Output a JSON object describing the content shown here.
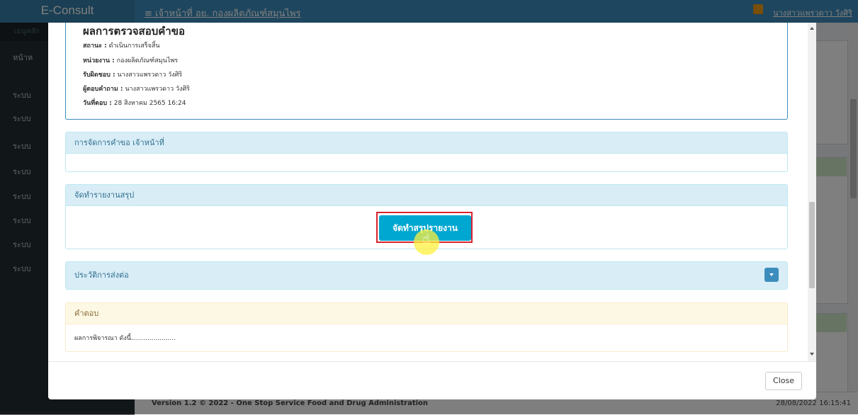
{
  "app": {
    "logo": "E-Consult",
    "header_title": "≡  เจ้าหน้าที่ อย. กองผลิตภัณฑ์สมุนไพร",
    "user_name": "นางสาวแพรวดาว วังศิริ",
    "sidebar_head": "เมนูหลัก",
    "sidebar_items": [
      "หน้าห",
      "ระบบ",
      "ระบบ",
      "ระบบ",
      "ระบบ",
      "ระบบ",
      "ระบบ",
      "ระบบ",
      "ระบบ"
    ],
    "footer_text": "Version 1.2 © 2022 - One Stop Service Food and Drug Administration",
    "footer_time": "28/08/2022 16:15:41"
  },
  "modal": {
    "result": {
      "title": "ผลการตรวจสอบคำขอ",
      "rows": [
        {
          "label": "สถานะ :",
          "value": "ดำเนินการเสร็จสิ้น"
        },
        {
          "label": "หน่วยงาน :",
          "value": "กองผลิตภัณฑ์สมุนไพร"
        },
        {
          "label": "รับผิดชอบ :",
          "value": "นางสาวแพรวดาว วังศิริ"
        },
        {
          "label": "ผู้ตอบคำถาม :",
          "value": "นางสาวแพรวดาว วังศิริ"
        },
        {
          "label": "วันที่ตอบ :",
          "value": "28 สิงหาคม 2565 16:24"
        }
      ]
    },
    "manage_section": {
      "title": "การจัดการคำขอ เจ้าหน้าที่"
    },
    "report_section": {
      "title": "จัดทำรายงานสรุป",
      "button_label": "จัดทำสรุปรายงาน"
    },
    "history_section": {
      "title": "ประวัติการส่งต่อ"
    },
    "answer_section": {
      "title": "คำตอบ",
      "body": "ผลการพิจารณา ดังนี้......................"
    },
    "close_label": "Close"
  },
  "colors": {
    "primary": "#3c8dbc",
    "button": "#00a7d0",
    "highlight": "#d9232e"
  }
}
